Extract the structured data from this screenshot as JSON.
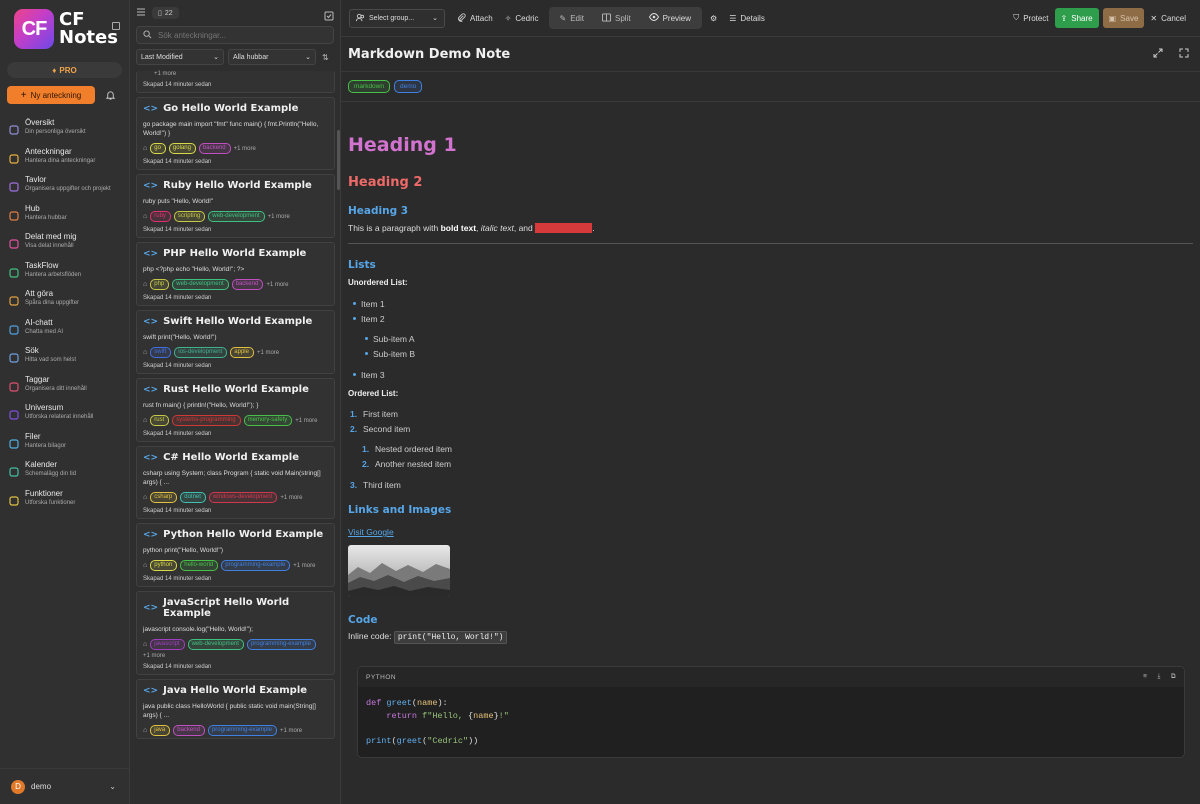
{
  "sidebar": {
    "logo_mark": "CF",
    "logo_word1": "CF",
    "logo_word2": "Notes",
    "pro_label": "PRO",
    "new_note_label": "Ny anteckning",
    "items": [
      {
        "title": "Översikt",
        "sub": "Din personliga översikt",
        "icon": "grid-icon",
        "color": "#8f8fd8"
      },
      {
        "title": "Anteckningar",
        "sub": "Hantera dina anteckningar",
        "icon": "note-icon",
        "color": "#e8b040"
      },
      {
        "title": "Tavlor",
        "sub": "Organisera uppgifter och projekt",
        "icon": "board-icon",
        "color": "#a070e0"
      },
      {
        "title": "Hub",
        "sub": "Hantera hubbar",
        "icon": "people-icon",
        "color": "#e08040"
      },
      {
        "title": "Delat med mig",
        "sub": "Visa delat innehåll",
        "icon": "share-user-icon",
        "color": "#e050a0"
      },
      {
        "title": "TaskFlow",
        "sub": "Hantera arbetsflöden",
        "icon": "flow-icon",
        "color": "#40c080"
      },
      {
        "title": "Att göra",
        "sub": "Spåra dina uppgifter",
        "icon": "checklist-icon",
        "color": "#e0a040"
      },
      {
        "title": "AI-chatt",
        "sub": "Chatta med AI",
        "icon": "ai-chat-icon",
        "color": "#50a0e0"
      },
      {
        "title": "Sök",
        "sub": "Hitta vad som helst",
        "icon": "search-icon",
        "color": "#70a0e0"
      },
      {
        "title": "Taggar",
        "sub": "Organisera ditt innehåll",
        "icon": "tag-icon",
        "color": "#e05070"
      },
      {
        "title": "Universum",
        "sub": "Utforska relaterat innehåll",
        "icon": "universe-icon",
        "color": "#8050e0"
      },
      {
        "title": "Filer",
        "sub": "Hantera bilagor",
        "icon": "file-icon",
        "color": "#50b0e0"
      },
      {
        "title": "Kalender",
        "sub": "Schemalägg din tid",
        "icon": "calendar-icon",
        "color": "#40c0a0"
      },
      {
        "title": "Funktioner",
        "sub": "Utforska funktioner",
        "icon": "bulb-icon",
        "color": "#e0c040"
      }
    ],
    "user": {
      "initial": "D",
      "name": "demo"
    }
  },
  "list": {
    "count": "22",
    "search_placeholder": "Sök anteckningar...",
    "sort_value": "Last Modified",
    "hub_value": "Alla hubbar",
    "partial_more": "+1 more",
    "partial_created": "Skapad 14 minuter sedan",
    "notes": [
      {
        "title": "Go Hello World Example",
        "preview": "go package main import \"fmt\" func main() { fmt.Println(\"Hello, World!\") }",
        "tags": [
          "go",
          "golang",
          "backend"
        ],
        "more": "+1 more",
        "created": "Skapad 14 minuter sedan"
      },
      {
        "title": "Ruby Hello World Example",
        "preview": "ruby puts \"Hello, World!\"",
        "tags": [
          "ruby",
          "scripting",
          "web-development"
        ],
        "more": "+1 more",
        "created": "Skapad 14 minuter sedan"
      },
      {
        "title": "PHP Hello World Example",
        "preview": "php <?php echo \"Hello, World!\"; ?>",
        "tags": [
          "php",
          "web-development",
          "backend"
        ],
        "more": "+1 more",
        "created": "Skapad 14 minuter sedan"
      },
      {
        "title": "Swift Hello World Example",
        "preview": "swift print(\"Hello, World!\")",
        "tags": [
          "swift",
          "ios-development",
          "apple"
        ],
        "more": "+1 more",
        "created": "Skapad 14 minuter sedan"
      },
      {
        "title": "Rust Hello World Example",
        "preview": "rust fn main() { println!(\"Hello, World!\"); }",
        "tags": [
          "rust",
          "systems-programming",
          "memory-safety"
        ],
        "more": "+1 more",
        "created": "Skapad 14 minuter sedan"
      },
      {
        "title": "C# Hello World Example",
        "preview": "csharp using System; class Program { static void Main(string[] args) { ...",
        "tags": [
          "csharp",
          "dotnet",
          "windows-development"
        ],
        "more": "+1 more",
        "created": "Skapad 14 minuter sedan"
      },
      {
        "title": "Python Hello World Example",
        "preview": "python print(\"Hello, World!\")",
        "tags": [
          "python",
          "hello-world",
          "programming-example"
        ],
        "more": "+1 more",
        "created": "Skapad 14 minuter sedan"
      },
      {
        "title": "JavaScript Hello World Example",
        "preview": "javascript console.log(\"Hello, World!\");",
        "tags": [
          "javascript",
          "web-development",
          "programming-example"
        ],
        "more": "+1 more",
        "created": "Skapad 14 minuter sedan"
      },
      {
        "title": "Java Hello World Example",
        "preview": "java public class HelloWorld { public static void main(String[] args) { ...",
        "tags": [
          "java",
          "backend",
          "programming-example"
        ],
        "more": "+1 more",
        "created": ""
      }
    ],
    "tag_colors": {
      "go": "#d8d848",
      "golang": "#d8d848",
      "backend": "#c050c0",
      "ruby": "#e03070",
      "scripting": "#c8c848",
      "web-development": "#40c080",
      "php": "#c8c848",
      "swift": "#4070e0",
      "ios-development": "#40b090",
      "apple": "#e0c040",
      "rust": "#c8c848",
      "systems-programming": "#d03838",
      "memory-safety": "#48c048",
      "csharp": "#e0c040",
      "dotnet": "#40c0b0",
      "windows-development": "#d03850",
      "python": "#d8d848",
      "hello-world": "#48c048",
      "programming-example": "#4080e0",
      "javascript": "#a040c0",
      "java": "#e0c040"
    }
  },
  "toolbar": {
    "group_select": "Select group...",
    "attach": "Attach",
    "cedric": "Cedric",
    "edit": "Edit",
    "split": "Split",
    "preview": "Preview",
    "details": "Details",
    "protect": "Protect",
    "share": "Share",
    "save": "Save",
    "cancel": "Cancel"
  },
  "note": {
    "title": "Markdown Demo Note",
    "tags": [
      "markdown",
      "demo"
    ],
    "h1": "Heading 1",
    "h2": "Heading 2",
    "h3": "Heading 3",
    "para_start": "This is a paragraph with ",
    "para_bold": "bold text",
    "para_mid1": ", ",
    "para_italic": "italic text",
    "para_mid2": ", and ",
    "para_highlight": "highlighted text",
    "para_end": ".",
    "lists_heading": "Lists",
    "unordered_label": "Unordered List:",
    "unordered": [
      "Item 1",
      "Item 2"
    ],
    "sub_items": [
      "Sub-item A",
      "Sub-item B"
    ],
    "item3": "Item 3",
    "ordered_label": "Ordered List:",
    "ordered": [
      "First item",
      "Second item"
    ],
    "nested_ordered": [
      "Nested ordered item",
      "Another nested item"
    ],
    "third": "Third item",
    "links_heading": "Links and Images",
    "link_text": "Visit Google",
    "code_heading": "Code",
    "inline_label": "Inline code:",
    "inline_code": "print(\"Hello, World!\")",
    "code_lang": "PYTHON",
    "code_lines": [
      [
        [
          "kw",
          "def "
        ],
        [
          "fn",
          "greet"
        ],
        [
          "",
          "("
        ],
        [
          "va",
          "name"
        ],
        [
          "",
          "):"
        ]
      ],
      [
        [
          "",
          "    "
        ],
        [
          "kw",
          "return "
        ],
        [
          "st",
          "f\"Hello, "
        ],
        [
          "",
          "{"
        ],
        [
          "va",
          "name"
        ],
        [
          "",
          "}"
        ],
        [
          "st",
          "!\""
        ]
      ],
      [
        [
          "",
          ""
        ]
      ],
      [
        [
          "fn",
          "print"
        ],
        [
          "",
          "("
        ],
        [
          "fn",
          "greet"
        ],
        [
          "",
          "("
        ],
        [
          "st",
          "\"Cedric\""
        ],
        [
          "",
          "))"
        ]
      ]
    ]
  }
}
